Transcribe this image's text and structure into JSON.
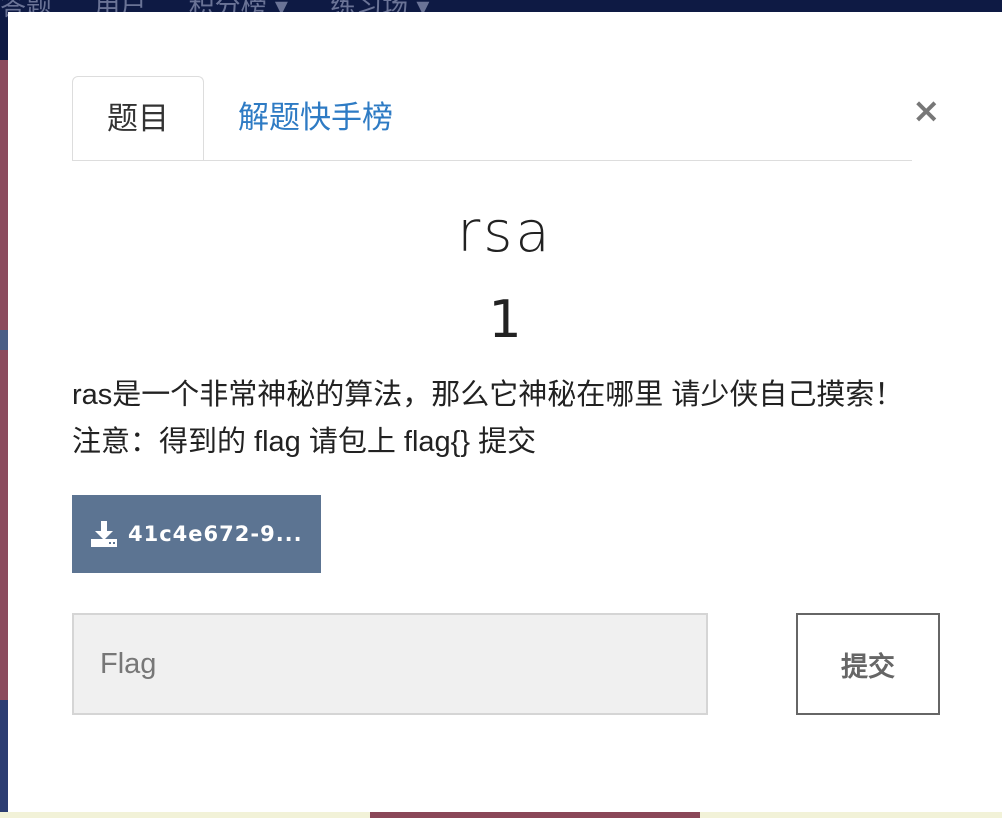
{
  "background": {
    "nav_items": [
      "答题",
      "用户",
      "积分榜 ▾",
      "练习场 ▾"
    ]
  },
  "modal": {
    "close_label": "×",
    "tabs": [
      {
        "label": "题目",
        "active": true
      },
      {
        "label": "解题快手榜",
        "active": false
      }
    ],
    "challenge": {
      "name": "rsa",
      "points": "1",
      "description": "ras是一个非常神秘的算法，那么它神秘在哪里 请少侠自己摸索！ 注意：得到的 flag 请包上 flag{} 提交"
    },
    "download": {
      "icon": "download-icon",
      "label": "41c4e672-9..."
    },
    "flag_input": {
      "placeholder": "Flag",
      "value": ""
    },
    "submit_label": "提交"
  },
  "colors": {
    "tab_link": "#2e7bc4",
    "download_button": "#5c7492",
    "input_bg": "#f0f0f0"
  }
}
